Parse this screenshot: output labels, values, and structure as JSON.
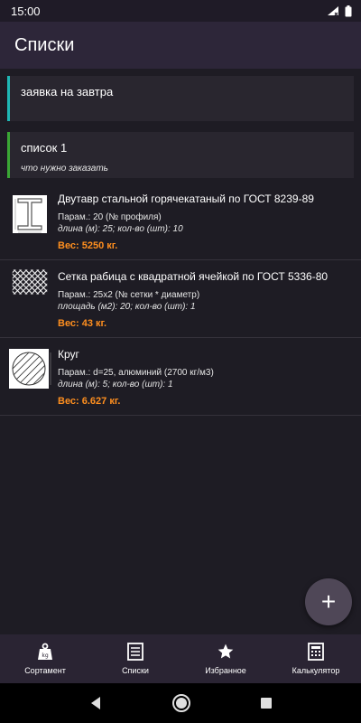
{
  "status_bar": {
    "time": "15:00",
    "icons": [
      "wifi-icon",
      "battery-icon"
    ]
  },
  "app_bar": {
    "title": "Списки"
  },
  "lists": [
    {
      "name": "заявка на завтра",
      "description": "",
      "accent": "#1fb7b5"
    },
    {
      "name": "список 1",
      "description": "что нужно заказать",
      "accent": "#3aa635"
    }
  ],
  "items": [
    {
      "icon": "i-beam-icon",
      "title": "Двутавр стальной горячекатаный по ГОСТ 8239-89",
      "params": "Парам.: 20 (№ профиля)",
      "dims": "длина (м): 25; кол-во (шт): 10",
      "weight": "Вес: 5250 кг."
    },
    {
      "icon": "mesh-icon",
      "title": "Сетка рабица с квадратной ячейкой по ГОСТ 5336-80",
      "params": "Парам.: 25x2 (№ сетки * диаметр)",
      "dims": "площадь (м2): 20; кол-во (шт): 1",
      "weight": "Вес: 43 кг."
    },
    {
      "icon": "round-bar-icon",
      "title": "Круг",
      "params": "Парам.: d=25, алюминий (2700 кг/м3)",
      "dims": "длина (м): 5; кол-во (шт): 1",
      "weight": "Вес: 6.627 кг."
    }
  ],
  "fab": {
    "label": "+"
  },
  "bottom_nav": [
    {
      "label": "Сортамент",
      "icon": "weight-icon"
    },
    {
      "label": "Списки",
      "icon": "list-icon"
    },
    {
      "label": "Избранное",
      "icon": "star-icon"
    },
    {
      "label": "Калькулятор",
      "icon": "calculator-icon"
    }
  ],
  "colors": {
    "weight": "#ff8f1f",
    "app_bar": "#2d2639",
    "background": "#1e1c24"
  }
}
